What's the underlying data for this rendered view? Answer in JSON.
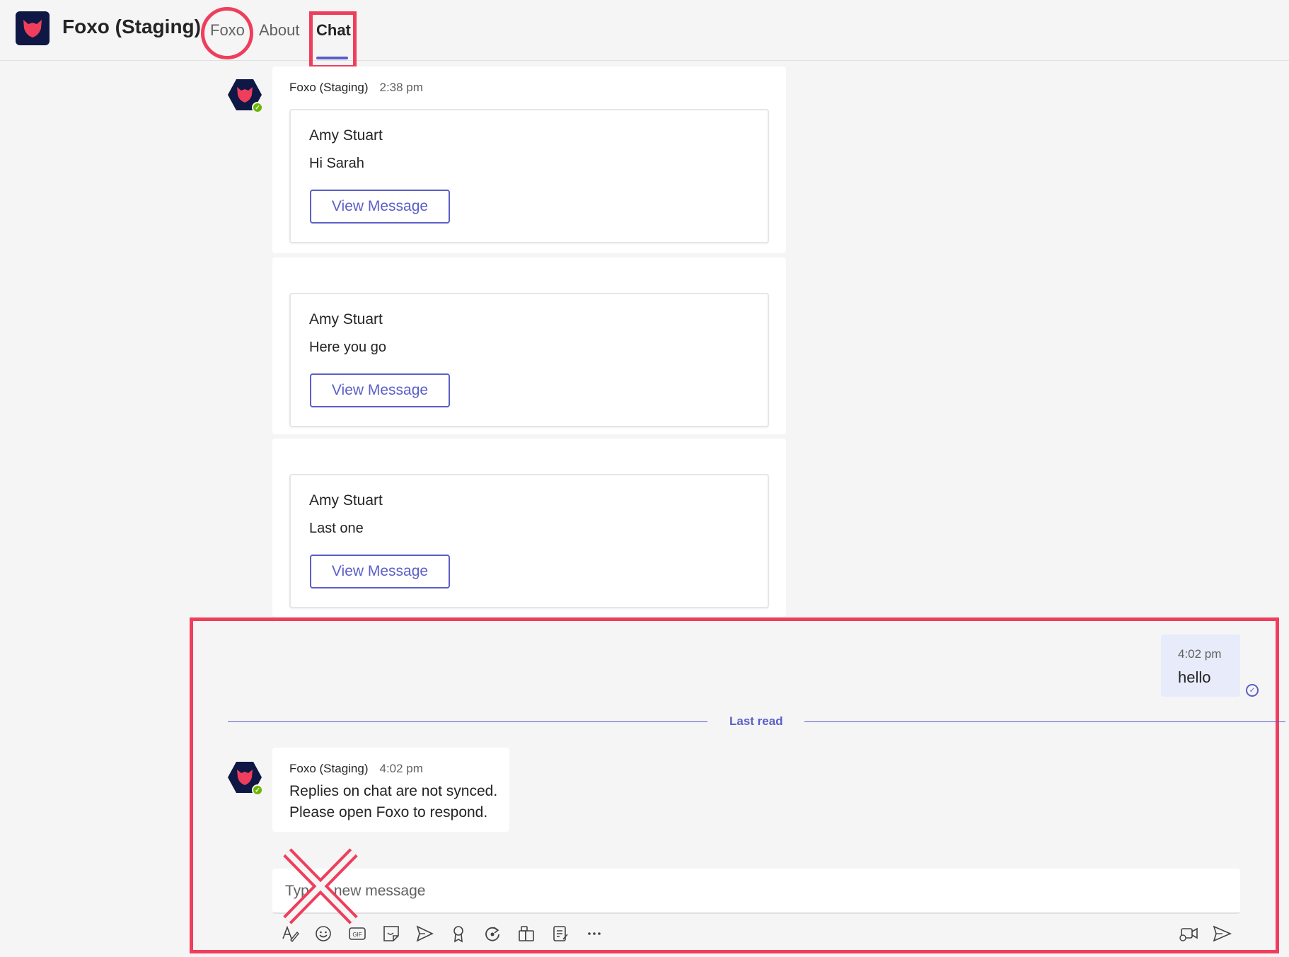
{
  "header": {
    "app_title": "Foxo (Staging)",
    "tabs": [
      {
        "label": "Foxo"
      },
      {
        "label": "About"
      },
      {
        "label": "Chat",
        "active": true
      }
    ]
  },
  "messages": {
    "first": {
      "sender": "Foxo (Staging)",
      "time": "2:38 pm"
    },
    "cards": [
      {
        "name": "Amy Stuart",
        "text": "Hi Sarah",
        "button": "View Message"
      },
      {
        "name": "Amy Stuart",
        "text": "Here you go",
        "button": "View Message"
      },
      {
        "name": "Amy Stuart",
        "text": "Last one",
        "button": "View Message"
      }
    ],
    "own": {
      "time": "4:02 pm",
      "text": "hello"
    },
    "divider": "Last read",
    "reply": {
      "sender": "Foxo (Staging)",
      "time": "4:02 pm",
      "line1": "Replies on chat are not synced.",
      "line2": "Please open Foxo to respond."
    }
  },
  "compose": {
    "placeholder": "Type a new message"
  },
  "toolbar": {
    "icons": [
      "format-icon",
      "emoji-icon",
      "gif-icon",
      "sticker-icon",
      "schedule-send-icon",
      "praise-icon",
      "loop-icon",
      "apps-icon",
      "forms-icon",
      "more-icon",
      "meet-now-icon",
      "send-icon"
    ]
  },
  "colors": {
    "accent": "#5b5fc7",
    "annotation": "#ef3e5c",
    "logo_bg": "#0f1744",
    "fox": "#ef3e5c",
    "status": "#6bb700"
  }
}
